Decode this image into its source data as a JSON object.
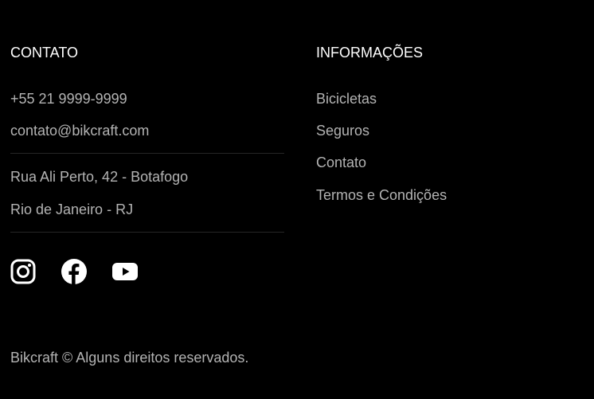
{
  "contact": {
    "heading": "CONTATO",
    "phone": "+55 21 9999-9999",
    "email": "contato@bikcraft.com",
    "address_line1": "Rua Ali Perto, 42 - Botafogo",
    "address_line2": "Rio de Janeiro - RJ",
    "social": [
      {
        "icon": "instagram-icon"
      },
      {
        "icon": "facebook-icon"
      },
      {
        "icon": "youtube-icon"
      }
    ]
  },
  "info": {
    "heading": "INFORMAÇÕES",
    "links": [
      {
        "label": "Bicicletas"
      },
      {
        "label": "Seguros"
      },
      {
        "label": "Contato"
      },
      {
        "label": "Termos e Condições"
      }
    ]
  },
  "footer": {
    "copyright": "Bikcraft © Alguns direitos reservados."
  },
  "colors": {
    "background": "#000000",
    "heading": "#ffffff",
    "text": "#b3b3b3",
    "divider": "#262626"
  }
}
